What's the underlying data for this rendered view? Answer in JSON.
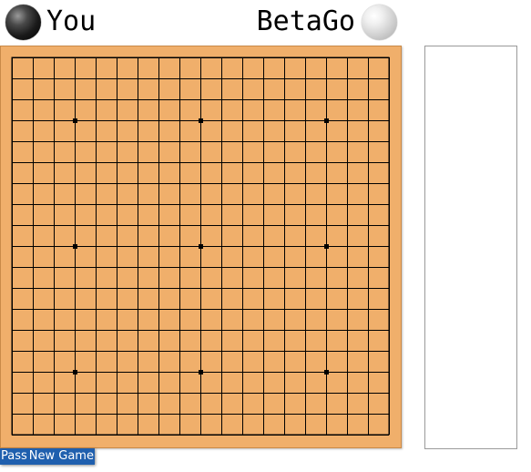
{
  "players": {
    "left": {
      "name": "You",
      "stone": "black"
    },
    "right": {
      "name": "BetaGo",
      "stone": "white"
    }
  },
  "board": {
    "size": 19,
    "color": "#f0af6b",
    "line_color": "#000000",
    "star_points": [
      [
        3,
        3
      ],
      [
        9,
        3
      ],
      [
        15,
        3
      ],
      [
        3,
        9
      ],
      [
        9,
        9
      ],
      [
        15,
        9
      ],
      [
        3,
        15
      ],
      [
        9,
        15
      ],
      [
        15,
        15
      ]
    ],
    "stones": []
  },
  "controls": {
    "pass_label": "Pass",
    "new_game_label": "New Game",
    "accent": "#1f5fae"
  }
}
